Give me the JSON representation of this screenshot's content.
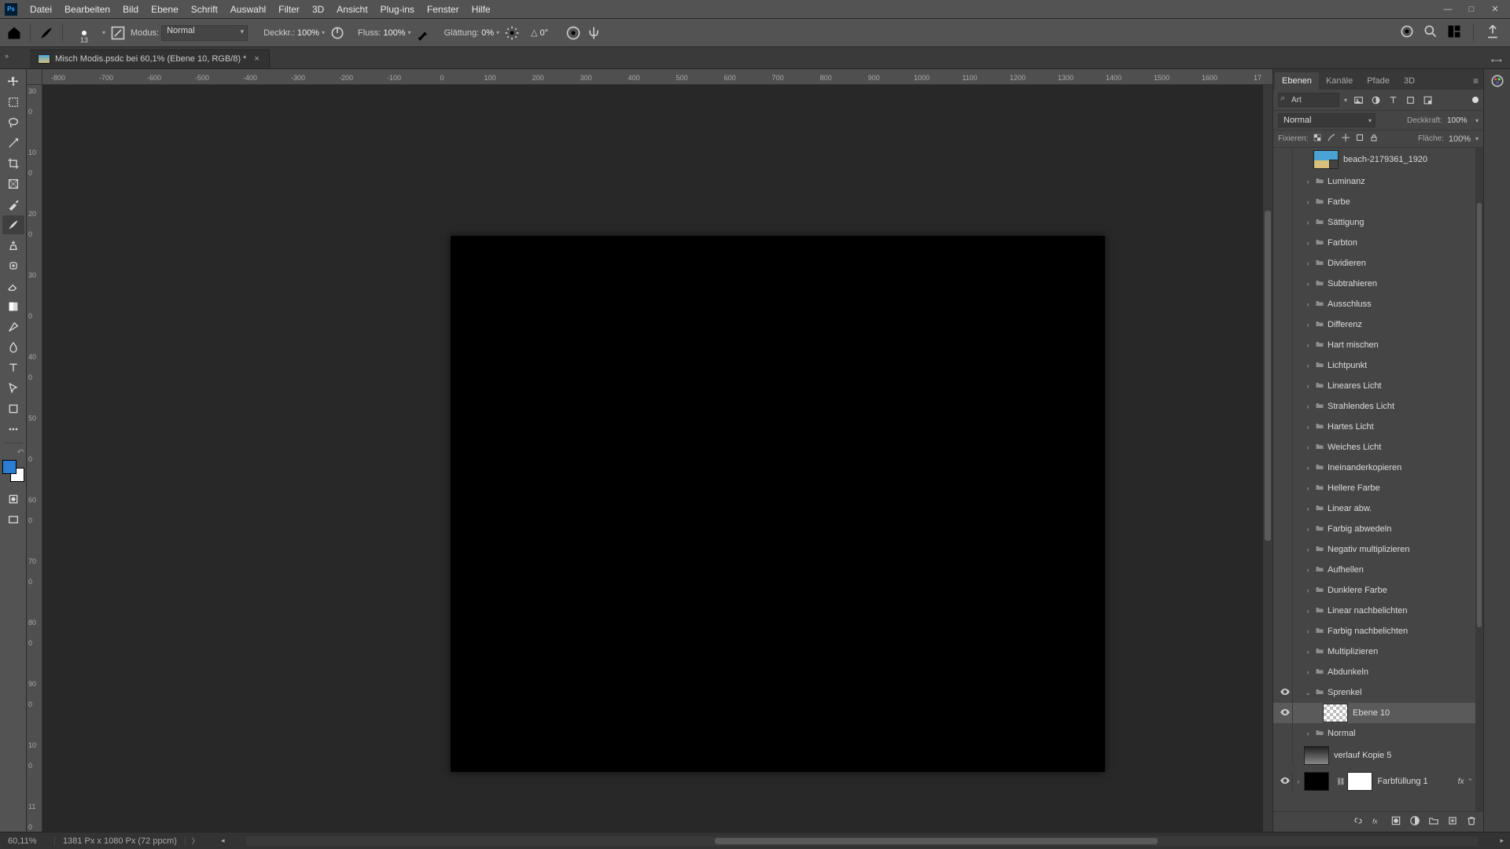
{
  "menu": {
    "items": [
      "Datei",
      "Bearbeiten",
      "Bild",
      "Ebene",
      "Schrift",
      "Auswahl",
      "Filter",
      "3D",
      "Ansicht",
      "Plug-ins",
      "Fenster",
      "Hilfe"
    ]
  },
  "options": {
    "brush_size": "13",
    "modus_label": "Modus:",
    "modus_value": "Normal",
    "deckkraft_label": "Deckkr.:",
    "deckkraft_value": "100%",
    "fluss_label": "Fluss:",
    "fluss_value": "100%",
    "glattung_label": "Glättung:",
    "glattung_value": "0%",
    "angle_icon": "△",
    "angle_value": "0°"
  },
  "doc": {
    "tab_title": "Misch Modis.psdc bei 60,1% (Ebene 10, RGB/8) *"
  },
  "ruler_h": [
    "-800",
    "-700",
    "-600",
    "-500",
    "-400",
    "-300",
    "-200",
    "-100",
    "0",
    "100",
    "200",
    "300",
    "400",
    "500",
    "600",
    "700",
    "800",
    "900",
    "1000",
    "1100",
    "1200",
    "1300",
    "1400",
    "1500",
    "1600",
    "17"
  ],
  "ruler_v": [
    "30",
    "0",
    "",
    "10",
    "0",
    "",
    "20",
    "0",
    "",
    "30",
    "",
    "0",
    "",
    "40",
    "0",
    "",
    "50",
    "",
    "0",
    "",
    "60",
    "0",
    "",
    "70",
    "0",
    "",
    "80",
    "0",
    "",
    "90",
    "0",
    "",
    "10",
    "0",
    "",
    "11",
    "0"
  ],
  "panels": {
    "tabs": [
      "Ebenen",
      "Kanäle",
      "Pfade",
      "3D"
    ],
    "search_value": "Art",
    "blend_value": "Normal",
    "deckkraft_label": "Deckkraft:",
    "deckkraft_value": "100%",
    "fixieren_label": "Fixieren:",
    "flache_label": "Fläche:",
    "flache_value": "100%"
  },
  "layers": [
    {
      "type": "smart",
      "name": "beach-2179361_1920",
      "indent": 1,
      "vis": false,
      "twist": "",
      "selected": false,
      "thumb": "image"
    },
    {
      "type": "group",
      "name": "Luminanz",
      "indent": 1,
      "vis": false,
      "twist": ">",
      "selected": false
    },
    {
      "type": "group",
      "name": "Farbe",
      "indent": 1,
      "vis": false,
      "twist": ">",
      "selected": false
    },
    {
      "type": "group",
      "name": "Sättigung",
      "indent": 1,
      "vis": false,
      "twist": ">",
      "selected": false
    },
    {
      "type": "group",
      "name": "Farbton",
      "indent": 1,
      "vis": false,
      "twist": ">",
      "selected": false
    },
    {
      "type": "group",
      "name": "Dividieren",
      "indent": 1,
      "vis": false,
      "twist": ">",
      "selected": false
    },
    {
      "type": "group",
      "name": "Subtrahieren",
      "indent": 1,
      "vis": false,
      "twist": ">",
      "selected": false
    },
    {
      "type": "group",
      "name": "Ausschluss",
      "indent": 1,
      "vis": false,
      "twist": ">",
      "selected": false
    },
    {
      "type": "group",
      "name": "Differenz",
      "indent": 1,
      "vis": false,
      "twist": ">",
      "selected": false
    },
    {
      "type": "group",
      "name": "Hart mischen",
      "indent": 1,
      "vis": false,
      "twist": ">",
      "selected": false
    },
    {
      "type": "group",
      "name": "Lichtpunkt",
      "indent": 1,
      "vis": false,
      "twist": ">",
      "selected": false
    },
    {
      "type": "group",
      "name": "Lineares Licht",
      "indent": 1,
      "vis": false,
      "twist": ">",
      "selected": false
    },
    {
      "type": "group",
      "name": "Strahlendes Licht",
      "indent": 1,
      "vis": false,
      "twist": ">",
      "selected": false
    },
    {
      "type": "group",
      "name": "Hartes Licht",
      "indent": 1,
      "vis": false,
      "twist": ">",
      "selected": false
    },
    {
      "type": "group",
      "name": "Weiches Licht",
      "indent": 1,
      "vis": false,
      "twist": ">",
      "selected": false
    },
    {
      "type": "group",
      "name": "Ineinanderkopieren",
      "indent": 1,
      "vis": false,
      "twist": ">",
      "selected": false
    },
    {
      "type": "group",
      "name": "Hellere Farbe",
      "indent": 1,
      "vis": false,
      "twist": ">",
      "selected": false
    },
    {
      "type": "group",
      "name": "Linear abw.",
      "indent": 1,
      "vis": false,
      "twist": ">",
      "selected": false
    },
    {
      "type": "group",
      "name": "Farbig abwedeln",
      "indent": 1,
      "vis": false,
      "twist": ">",
      "selected": false
    },
    {
      "type": "group",
      "name": "Negativ multiplizieren",
      "indent": 1,
      "vis": false,
      "twist": ">",
      "selected": false
    },
    {
      "type": "group",
      "name": "Aufhellen",
      "indent": 1,
      "vis": false,
      "twist": ">",
      "selected": false
    },
    {
      "type": "group",
      "name": "Dunklere Farbe",
      "indent": 1,
      "vis": false,
      "twist": ">",
      "selected": false
    },
    {
      "type": "group",
      "name": "Linear nachbelichten",
      "indent": 1,
      "vis": false,
      "twist": ">",
      "selected": false
    },
    {
      "type": "group",
      "name": "Farbig nachbelichten",
      "indent": 1,
      "vis": false,
      "twist": ">",
      "selected": false
    },
    {
      "type": "group",
      "name": "Multiplizieren",
      "indent": 1,
      "vis": false,
      "twist": ">",
      "selected": false
    },
    {
      "type": "group",
      "name": "Abdunkeln",
      "indent": 1,
      "vis": false,
      "twist": ">",
      "selected": false
    },
    {
      "type": "group",
      "name": "Sprenkel",
      "indent": 1,
      "vis": true,
      "twist": "v",
      "selected": false
    },
    {
      "type": "layer",
      "name": "Ebene 10",
      "indent": 2,
      "vis": true,
      "twist": "",
      "selected": true,
      "thumb": "checker"
    },
    {
      "type": "group",
      "name": "Normal",
      "indent": 1,
      "vis": false,
      "twist": ">",
      "selected": false
    },
    {
      "type": "layer",
      "name": "verlauf Kopie 5",
      "indent": 0,
      "vis": false,
      "twist": "",
      "selected": false,
      "thumb": "grad"
    },
    {
      "type": "fill",
      "name": "Farbfüllung 1",
      "indent": 0,
      "vis": true,
      "twist": ">",
      "selected": false,
      "thumb": "black",
      "mask": true,
      "fx": true
    }
  ],
  "status": {
    "zoom": "60,11%",
    "docinfo": "1381 Px x 1080 Px (72 ppcm)"
  },
  "colors": {
    "canvas_bg": "#282828",
    "panel": "#454545",
    "artboard": "#000000",
    "fg_swatch": "#2a7dd1"
  }
}
